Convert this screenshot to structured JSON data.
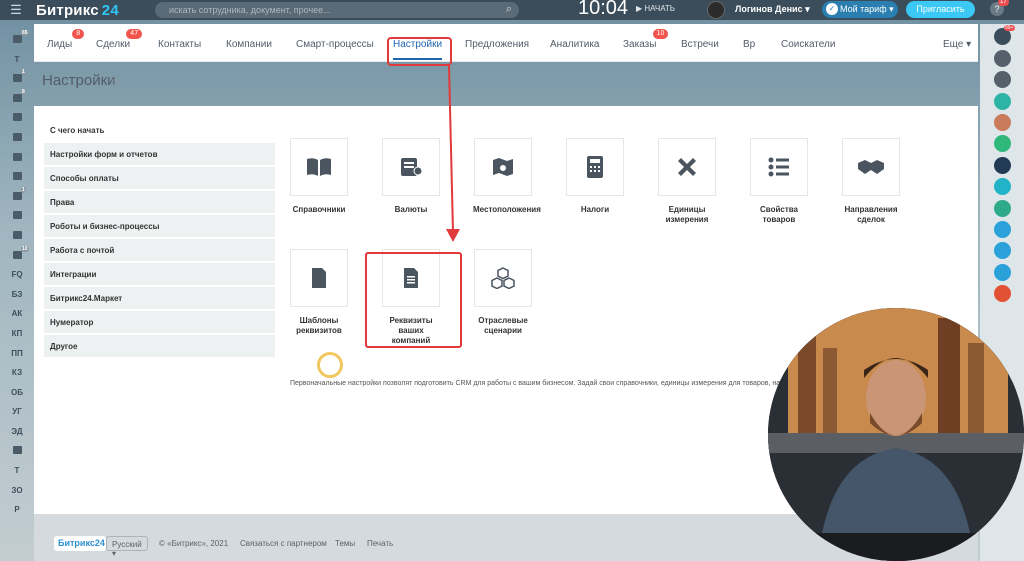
{
  "header": {
    "logo_text": "Битрикс",
    "logo_num": "24",
    "search_placeholder": "искать сотрудника, документ, прочее...",
    "clock": "10:04",
    "start_label": "НАЧАТЬ",
    "user_name": "Логинов Денис",
    "tariff_label": "Мой тариф",
    "invite_label": "Пригласить",
    "help_badge": "17"
  },
  "tabs": [
    {
      "label": "Лиды",
      "badge": "8"
    },
    {
      "label": "Сделки",
      "badge": "47"
    },
    {
      "label": "Контакты",
      "badge": ""
    },
    {
      "label": "Компании",
      "badge": ""
    },
    {
      "label": "Смарт-процессы",
      "badge": ""
    },
    {
      "label": "Настройки",
      "badge": "",
      "active": true
    },
    {
      "label": "Предложения",
      "badge": ""
    },
    {
      "label": "Аналитика",
      "badge": ""
    },
    {
      "label": "Заказы",
      "badge": "10"
    },
    {
      "label": "Встречи",
      "badge": ""
    },
    {
      "label": "Вр",
      "badge": ""
    },
    {
      "label": "Соискатели",
      "badge": ""
    },
    {
      "label": "Еще",
      "badge": ""
    }
  ],
  "page": {
    "title": "Настройки"
  },
  "menu": {
    "heading": "С чего начать",
    "items": [
      "Настройки форм и отчетов",
      "Способы оплаты",
      "Права",
      "Роботы и бизнес-процессы",
      "Работа с почтой",
      "Интеграции",
      "Битрикс24.Маркет",
      "Нумератор",
      "Другое"
    ]
  },
  "tiles": [
    {
      "label": "Справочники",
      "icon": "book-icon"
    },
    {
      "label": "Валюты",
      "icon": "currency-icon"
    },
    {
      "label": "Местоположения",
      "icon": "map-icon"
    },
    {
      "label": "Налоги",
      "icon": "calculator-icon"
    },
    {
      "label": "Единицы измерения",
      "icon": "ruler-pencil-icon"
    },
    {
      "label": "Свойства товаров",
      "icon": "list-icon"
    },
    {
      "label": "Направления сделок",
      "icon": "handshake-icon"
    },
    {
      "label": "Шаблоны реквизитов",
      "icon": "document-icon"
    },
    {
      "label": "Реквизиты ваших компаний",
      "icon": "document-lines-icon"
    },
    {
      "label": "Отраслевые сценарии",
      "icon": "boxes-icon"
    }
  ],
  "description": "Первоначальные настройки позволят подготовить CRM для работы с вашим бизнесом. Задай свои справочники, единицы измерения для товаров, налоги, валюту и д",
  "footer": {
    "logo": "Битрикс24",
    "language": "Русский",
    "copyright": "© «Битрикс», 2021",
    "partner": "Связаться с партнером",
    "themes": "Темы",
    "print": "Печать"
  },
  "left_rail": [
    {
      "label": "",
      "badge": "65"
    },
    {
      "label": "Т",
      "badge": ""
    },
    {
      "label": "",
      "badge": "1"
    },
    {
      "label": "",
      "badge": "8"
    },
    {
      "label": "",
      "badge": ""
    },
    {
      "label": "",
      "badge": ""
    },
    {
      "label": "",
      "badge": ""
    },
    {
      "label": "",
      "badge": ""
    },
    {
      "label": "",
      "badge": "1"
    },
    {
      "label": "",
      "badge": ""
    },
    {
      "label": "",
      "badge": ""
    },
    {
      "label": "",
      "badge": "10"
    },
    {
      "label": "FQ",
      "badge": ""
    },
    {
      "label": "БЗ",
      "badge": ""
    },
    {
      "label": "АК",
      "badge": ""
    },
    {
      "label": "КП",
      "badge": ""
    },
    {
      "label": "ПП",
      "badge": ""
    },
    {
      "label": "КЗ",
      "badge": ""
    },
    {
      "label": "ОБ",
      "badge": ""
    },
    {
      "label": "УГ",
      "badge": ""
    },
    {
      "label": "ЭД",
      "badge": ""
    },
    {
      "label": "",
      "badge": ""
    },
    {
      "label": "Т",
      "badge": ""
    },
    {
      "label": "ЗО",
      "badge": ""
    },
    {
      "label": "Р",
      "badge": ""
    }
  ],
  "right_rail": [
    {
      "color": "#3b4d5a",
      "badge": "99+"
    },
    {
      "color": "#55606b",
      "badge": ""
    },
    {
      "color": "#55606b",
      "badge": ""
    },
    {
      "color": "#2eb4a6",
      "badge": ""
    },
    {
      "color": "#c97b5a",
      "badge": ""
    },
    {
      "color": "#2fb87a",
      "badge": ""
    },
    {
      "color": "#233a56",
      "badge": ""
    },
    {
      "color": "#22b3c8",
      "badge": ""
    },
    {
      "color": "#2eaa8a",
      "badge": ""
    },
    {
      "color": "#2aa1d8",
      "badge": ""
    },
    {
      "color": "#2aa1d8",
      "badge": ""
    },
    {
      "color": "#2aa1d8",
      "badge": ""
    },
    {
      "color": "#e05233",
      "badge": ""
    }
  ],
  "colors": {
    "accent": "#2066b0",
    "highlight": "#e03a3a",
    "topbar": "#3b4d5a",
    "invite": "#3bc8f5"
  }
}
